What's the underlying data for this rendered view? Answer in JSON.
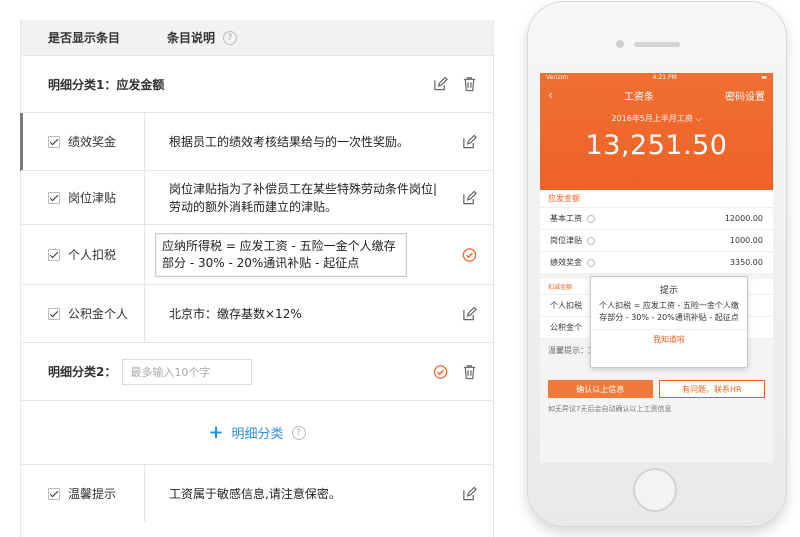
{
  "table": {
    "col_show": "是否显示条目",
    "col_desc": "条目说明",
    "category1": "明细分类1：应发金额",
    "category2_label": "明细分类2：",
    "category2_placeholder": "最多输入10个字",
    "add_category": "明细分类",
    "rows": [
      {
        "name": "绩效奖金",
        "desc": "根据员工的绩效考核结果给与的一次性奖励。"
      },
      {
        "name": "岗位津贴",
        "desc": "岗位津贴指为了补偿员工在某些特殊劳动条件岗位|劳动的额外消耗而建立的津贴。"
      },
      {
        "name": "个人扣税",
        "desc": "应纳所得税 = 应发工资 - 五险一金个人缴存部分 - 30% - 20%通讯补贴 - 起征点"
      },
      {
        "name": "公积金个人",
        "desc": "北京市：缴存基数×12%"
      }
    ],
    "warm_row": {
      "name": "温馨提示",
      "desc": "工资属于敏感信息,请注意保密。"
    }
  },
  "phone": {
    "carrier": "Verizon",
    "time": "4:21 PM",
    "title": "工资条",
    "nav_right": "密码设置",
    "period": "2016年5月上半月工资",
    "amount": "13,251.50",
    "section1": "应发金额",
    "items": [
      {
        "label": "基本工资",
        "value": "12000.00"
      },
      {
        "label": "岗位津贴",
        "value": "1000.00"
      },
      {
        "label": "绩效奖金",
        "value": "3350.00"
      }
    ],
    "section2": "扣减金额",
    "deduct1": "个人扣税",
    "deduct2": "公积金个",
    "popup_title": "提示",
    "popup_body": "个人扣税 = 应发工资 - 五险一金个人缴存部分 - 30% - 20%通讯补贴 - 起征点",
    "popup_btn": "我知道啦",
    "tip": "温馨提示：工资属于敏感信息，请注意保密",
    "confirm": "确认以上信息",
    "contact": "有问题，联系HR",
    "footer": "如无异议7天后会自动确认以上工资信息"
  },
  "colors": {
    "accent": "#ee6226",
    "link": "#2c8fdc"
  }
}
